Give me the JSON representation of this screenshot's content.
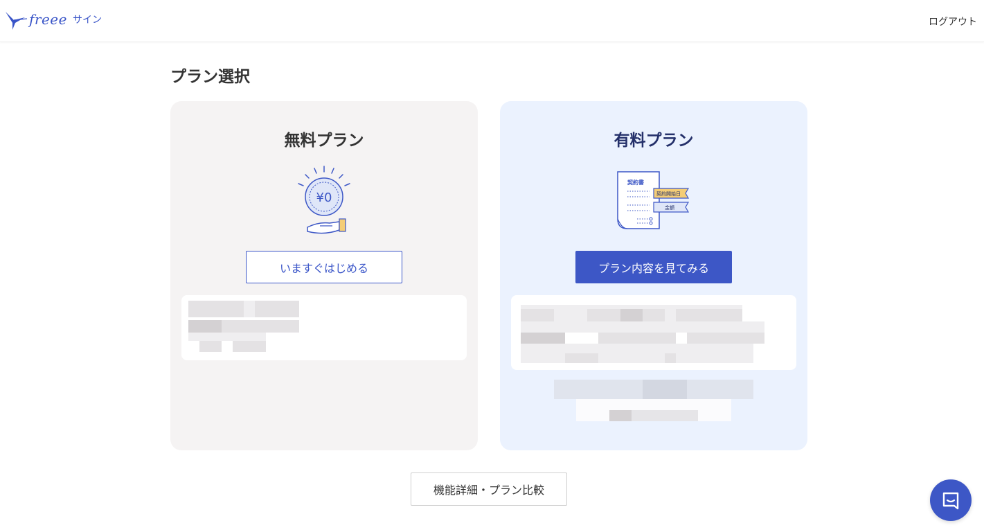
{
  "header": {
    "logo_text": "freee",
    "logo_sub": "サイン",
    "logout_label": "ログアウト"
  },
  "page": {
    "title": "プラン選択"
  },
  "plans": {
    "free": {
      "title": "無料プラン",
      "illustration_text": "¥0",
      "button_label": "いますぐはじめる"
    },
    "paid": {
      "title": "有料プラン",
      "doc_title": "契約書",
      "tag_start_date": "契約開始日",
      "tag_amount": "金額",
      "button_label": "プラン内容を見てみる"
    }
  },
  "compare": {
    "button_label": "機能詳細・プラン比較"
  },
  "chat": {
    "icon": "chat-icon"
  },
  "colors": {
    "brand": "#3d57c6",
    "free_card_bg": "#f5f3f3",
    "paid_card_bg": "#ebf2fe"
  }
}
